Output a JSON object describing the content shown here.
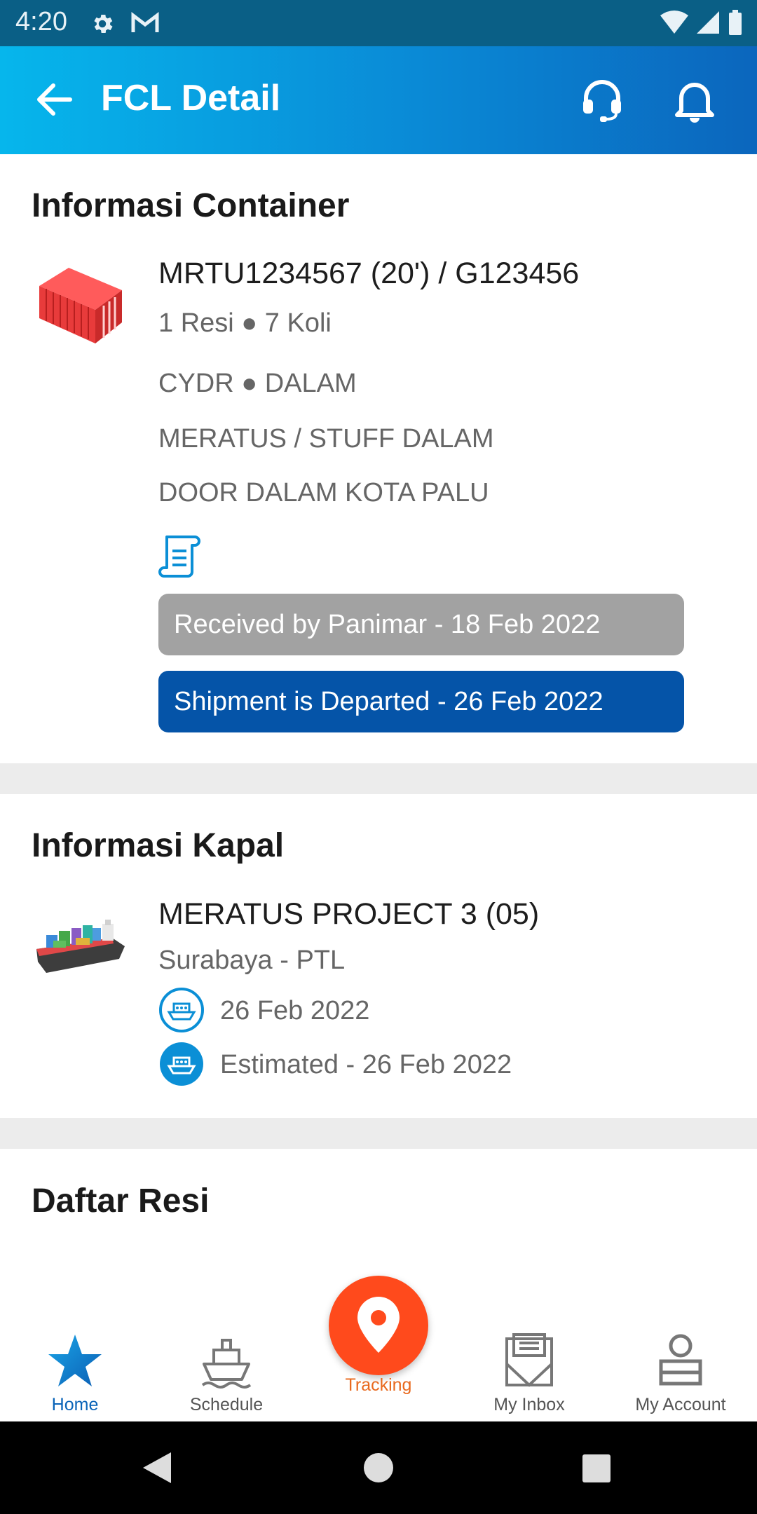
{
  "status_bar": {
    "time": "4:20"
  },
  "app_bar": {
    "title": "FCL Detail"
  },
  "container_info": {
    "title": "Informasi Container",
    "container_id": "MRTU1234567 (20') / G123456",
    "counts": "1 Resi ● 7 Koli",
    "line1": "CYDR ● DALAM",
    "line2": "MERATUS / STUFF DALAM",
    "line3": "DOOR DALAM KOTA PALU",
    "status_received": "Received by Panimar - 18 Feb 2022",
    "status_departed": "Shipment is Departed - 26 Feb 2022"
  },
  "vessel_info": {
    "title": "Informasi Kapal",
    "name": "MERATUS PROJECT 3 (05)",
    "route": "Surabaya - PTL",
    "departure": "26 Feb 2022",
    "arrival": "Estimated - 26 Feb 2022"
  },
  "receipt_list": {
    "title": "Daftar Resi"
  },
  "bottom_nav": {
    "home": "Home",
    "schedule": "Schedule",
    "tracking": "Tracking",
    "inbox": "My Inbox",
    "account": "My Account"
  },
  "colors": {
    "app_bar_start": "#06b6ec",
    "app_bar_end": "#0b66bd",
    "pill_grey": "#a2a2a2",
    "pill_blue": "#0554a8",
    "tracking_orange": "#ff4a1c",
    "nav_active": "#0b64b8"
  }
}
